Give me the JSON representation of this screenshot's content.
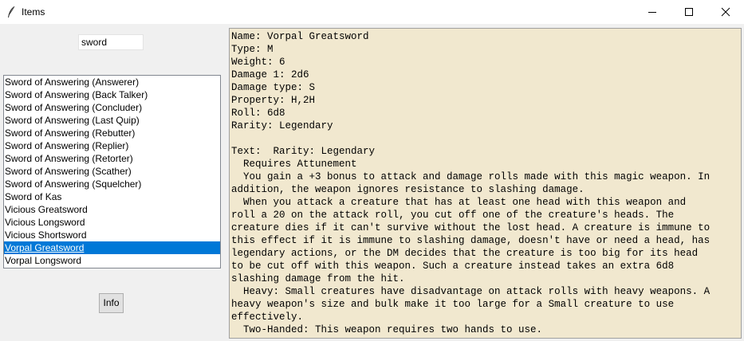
{
  "window": {
    "title": "Items"
  },
  "search": {
    "value": "sword"
  },
  "list": {
    "items": [
      "Sword of Answering (Answerer)",
      "Sword of Answering (Back Talker)",
      "Sword of Answering (Concluder)",
      "Sword of Answering (Last Quip)",
      "Sword of Answering (Rebutter)",
      "Sword of Answering (Replier)",
      "Sword of Answering (Retorter)",
      "Sword of Answering (Scather)",
      "Sword of Answering (Squelcher)",
      "Sword of Kas",
      "Vicious Greatsword",
      "Vicious Longsword",
      "Vicious Shortsword",
      "Vorpal Greatsword",
      "Vorpal Longsword"
    ],
    "selected": "Vorpal Greatsword"
  },
  "info_button": {
    "label": "Info"
  },
  "details": {
    "lines": [
      "Name: Vorpal Greatsword",
      "Type: M",
      "Weight: 6",
      "Damage 1: 2d6",
      "Damage type: S",
      "Property: H,2H",
      "Roll: 6d8",
      "Rarity: Legendary",
      "",
      "Text:  Rarity: Legendary",
      "  Requires Attunement",
      "  You gain a +3 bonus to attack and damage rolls made with this magic weapon. In",
      "addition, the weapon ignores resistance to slashing damage.",
      "  When you attack a creature that has at least one head with this weapon and",
      "roll a 20 on the attack roll, you cut off one of the creature's heads. The",
      "creature dies if it can't survive without the lost head. A creature is immune to",
      "this effect if it is immune to slashing damage, doesn't have or need a head, has",
      "legendary actions, or the DM decides that the creature is too big for its head",
      "to be cut off with this weapon. Such a creature instead takes an extra 6d8",
      "slashing damage from the hit.",
      "  Heavy: Small creatures have disadvantage on attack rolls with heavy weapons. A",
      "heavy weapon's size and bulk make it too large for a Small creature to use",
      "effectively.",
      "  Two-Handed: This weapon requires two hands to use."
    ]
  }
}
